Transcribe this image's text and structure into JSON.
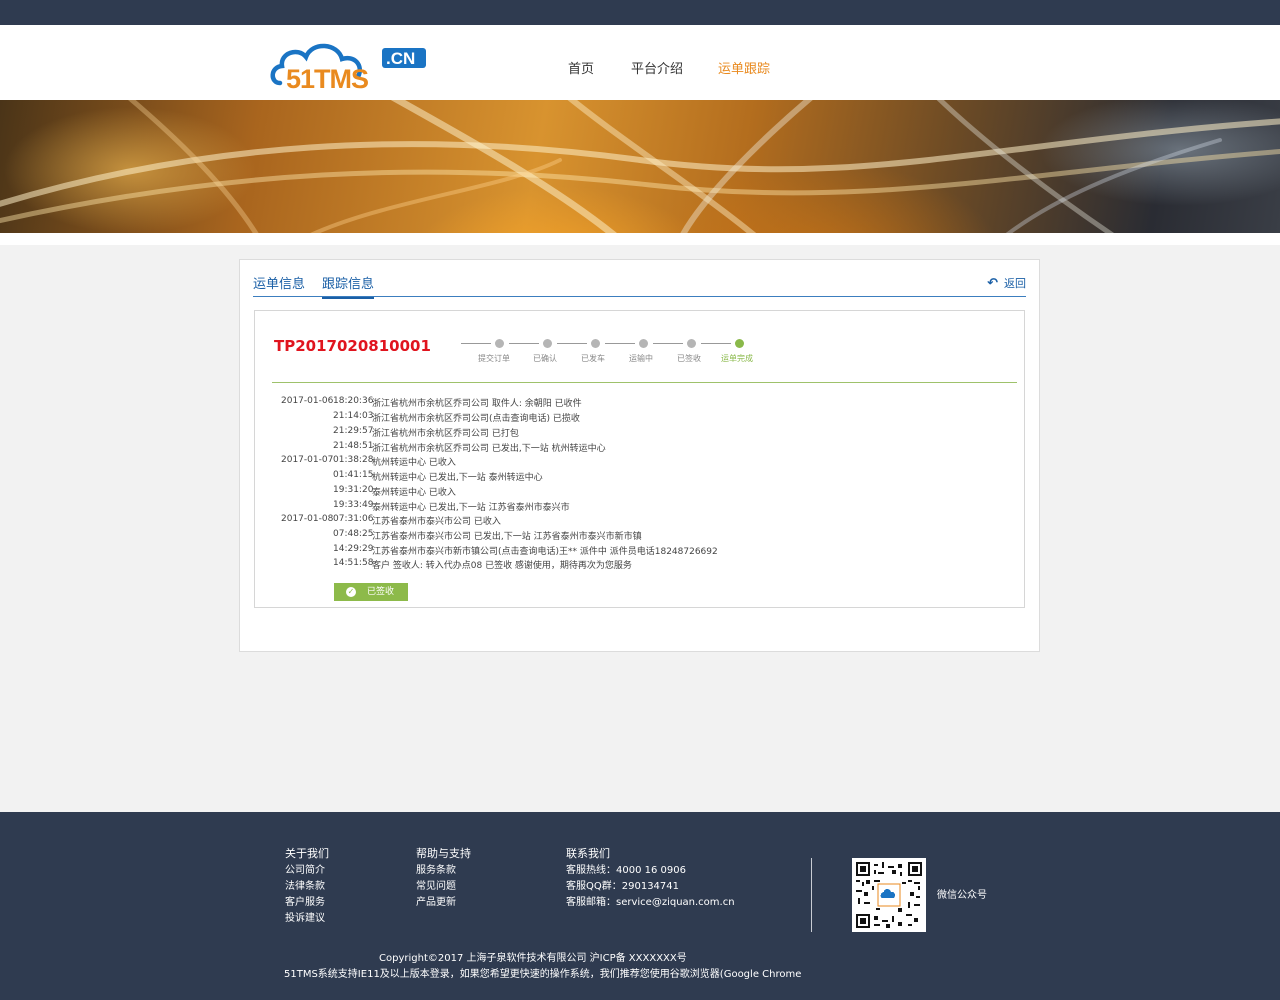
{
  "brand": {
    "logo_text": "51TMS",
    "logo_suffix": ".CN",
    "colors": {
      "blue": "#1a74c4",
      "orange": "#e98a1f",
      "nav_bg": "#2f3b50"
    }
  },
  "nav": {
    "items": [
      {
        "label": "首页",
        "active": false
      },
      {
        "label": "平台介绍",
        "active": false
      },
      {
        "label": "运单跟踪",
        "active": true
      }
    ]
  },
  "tabs": {
    "items": [
      {
        "label": "运单信息",
        "active": false
      },
      {
        "label": "跟踪信息",
        "active": true
      }
    ],
    "back_label": "返回"
  },
  "order": {
    "number": "TP2017020810001"
  },
  "progress": {
    "steps": [
      {
        "label": "提交订单",
        "done": false
      },
      {
        "label": "已确认",
        "done": false
      },
      {
        "label": "已发车",
        "done": false
      },
      {
        "label": "运输中",
        "done": false
      },
      {
        "label": "已签收",
        "done": false
      },
      {
        "label": "运单完成",
        "done": true
      }
    ]
  },
  "logs": [
    {
      "date": "2017-01-06",
      "time": "18:20:36",
      "text": "浙江省杭州市余杭区乔司公司 取件人: 余朝阳 已收件"
    },
    {
      "date": "",
      "time": "21:14:03",
      "text": "浙江省杭州市余杭区乔司公司(点击查询电话) 已揽收"
    },
    {
      "date": "",
      "time": "21:29:57",
      "text": "浙江省杭州市余杭区乔司公司 已打包"
    },
    {
      "date": "",
      "time": "21:48:51",
      "text": "浙江省杭州市余杭区乔司公司 已发出,下一站 杭州转运中心"
    },
    {
      "date": "2017-01-07",
      "time": "01:38:28",
      "text": "杭州转运中心 已收入"
    },
    {
      "date": "",
      "time": "01:41:15",
      "text": "杭州转运中心 已发出,下一站 泰州转运中心"
    },
    {
      "date": "",
      "time": "19:31:20",
      "text": "泰州转运中心 已收入"
    },
    {
      "date": "",
      "time": "19:33:49",
      "text": "泰州转运中心 已发出,下一站 江苏省泰州市泰兴市"
    },
    {
      "date": "2017-01-08",
      "time": "07:31:06",
      "text": "江苏省泰州市泰兴市公司 已收入"
    },
    {
      "date": "",
      "time": "07:48:25",
      "text": "江苏省泰州市泰兴市公司 已发出,下一站 江苏省泰州市泰兴市新市镇"
    },
    {
      "date": "",
      "time": "14:29:29",
      "text": "江苏省泰州市泰兴市新市镇公司(点击查询电话)王** 派件中 派件员电话18248726692"
    },
    {
      "date": "",
      "time": "14:51:58",
      "text": "客户 签收人: 转入代办点08 已签收 感谢使用，期待再次为您服务"
    }
  ],
  "status_button": {
    "label": "已签收",
    "icon": "check-circle-icon"
  },
  "footer": {
    "about": {
      "title": "关于我们",
      "items": [
        "公司简介",
        "法律条款",
        "客户服务",
        "投诉建议"
      ]
    },
    "help": {
      "title": "帮助与支持",
      "items": [
        "服务条款",
        "常见问题",
        "产品更新"
      ]
    },
    "contact": {
      "title": "联系我们",
      "items": [
        "客服热线：4000 16 0906",
        "客服QQ群：290134741",
        "客服邮箱：service@ziquan.com.cn"
      ]
    },
    "qr_label": "微信公众号",
    "copyright": "Copyright©2017  上海子泉软件技术有限公司  沪ICP备 XXXXXXX号",
    "browser_notice": "51TMS系统支持IE11及以上版本登录，如果您希望更快速的操作系统，我们推荐您使用谷歌浏览器(Google Chrome"
  }
}
